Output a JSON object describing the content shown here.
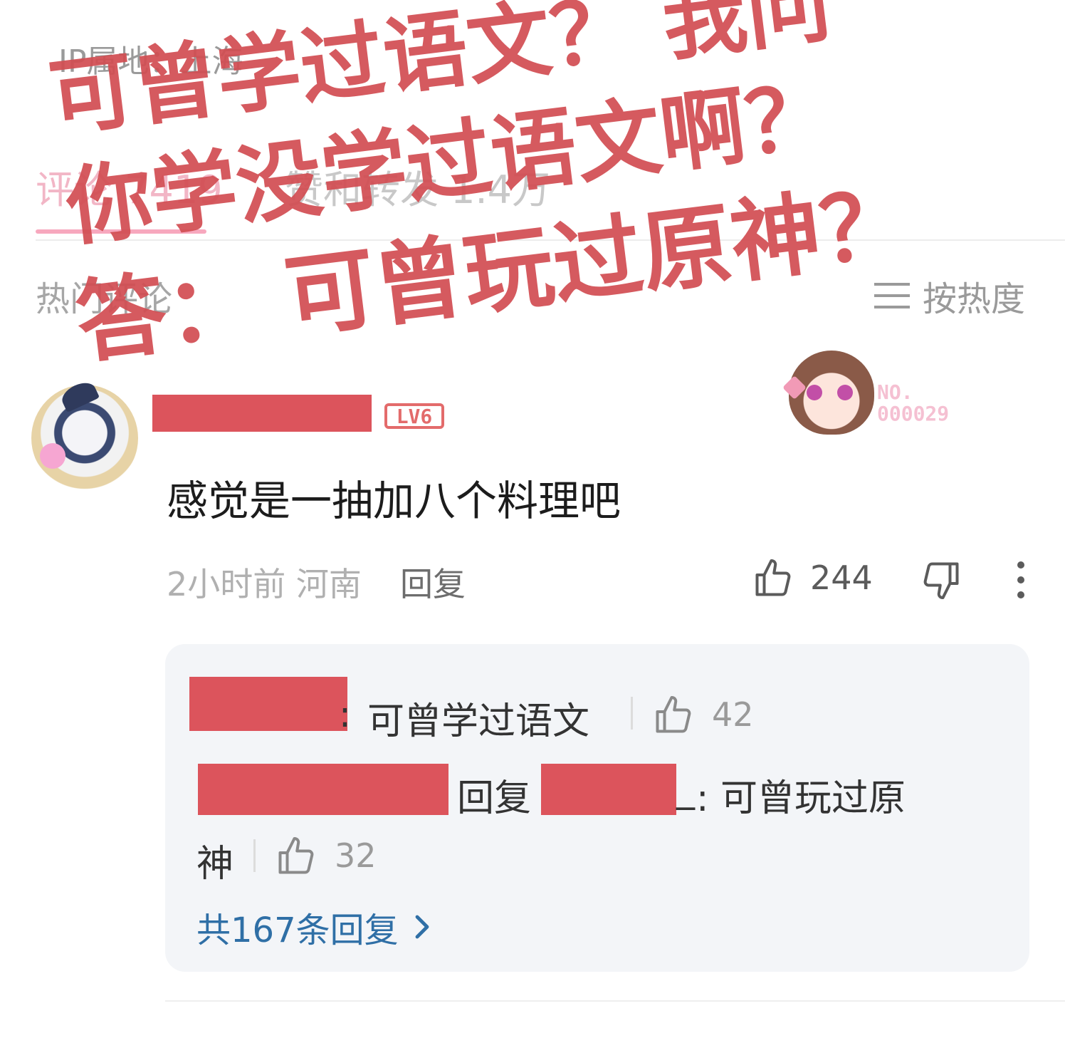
{
  "header": {
    "ip_location": "IP属地：上海"
  },
  "tabs": [
    {
      "label": "评论 7419",
      "active": true
    },
    {
      "label": "赞和转发 1.4万",
      "active": false
    }
  ],
  "comments_header": {
    "hot_label": "热门评论",
    "sort_label": "按热度"
  },
  "comment": {
    "level": "LV6",
    "badge": {
      "line1": "NO.",
      "line2": "000029"
    },
    "text": "感觉是一抽加八个料理吧",
    "meta": "2小时前 河南",
    "reply_label": "回复",
    "likes": "244",
    "icons": [
      "like-icon",
      "dislike-icon",
      "more-icon"
    ]
  },
  "replies": [
    {
      "colon": ":",
      "text": "可曾学过语文",
      "likes": "42"
    },
    {
      "reply_word": "回复",
      "underscore": "_",
      "text_line1": ": 可曾玩过原",
      "text_line2": "神",
      "likes": "32"
    }
  ],
  "total_replies": "共167条回复",
  "overlay_text": [
    "可曾学过语文？ 我问",
    "你学没学过语文啊？",
    "答： 可曾玩过原神？"
  ],
  "colors": {
    "overlay": "#d24d52",
    "redaction": "#dc545c",
    "link": "#2f6fa6",
    "accent_pink": "#f7a8be"
  }
}
